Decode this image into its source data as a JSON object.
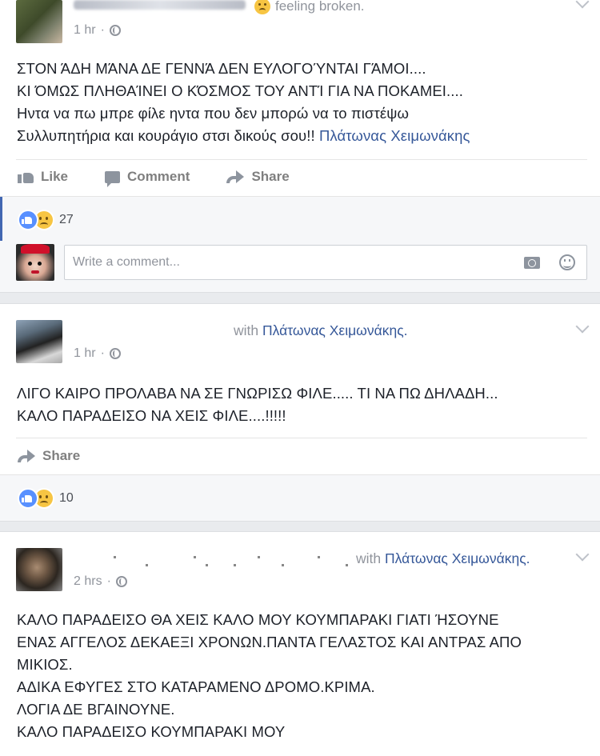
{
  "posts": [
    {
      "feeling": "feeling broken.",
      "time": "1 hr",
      "lines": [
        "ΣΤΟΝ ΆΔΗ ΜΆΝΑ ΔΕ ΓΕΝΝΆ ΔΕΝ ΕΥΛΟΓΟΎΝΤΑΙ ΓΆΜΟΙ....",
        "ΚΙ ΌΜΩΣ ΠΛΗΘΑΊΝΕΙ Ο ΚΌΣΜΟΣ ΤΟΥ ΑΝΤΊ ΓΙΑ ΝΑ ΠΟΚΑΜΕΙ....",
        "Ηντα να πω μπρε φίλε ηντα που δεν μπορώ να το πιστέψω"
      ],
      "last_line_prefix": "Συλλυπητήρια και κουράγιο στσι δικούς σου!!",
      "tagged": "Πλάτωνας Χειμωνάκης",
      "actions": {
        "like": "Like",
        "comment": "Comment",
        "share": "Share"
      },
      "reaction_count": "27",
      "comment_placeholder": "Write a comment..."
    },
    {
      "with_label": "with",
      "tagged": "Πλάτωνας Χειμωνάκης.",
      "time": "1 hr",
      "lines": [
        "ΛΙΓΟ ΚΑΙΡΟ ΠΡΟΛΑΒΑ ΝΑ ΣΕ ΓΝΩΡΙΣΩ ΦΙΛΕ..... ΤΙ ΝΑ ΠΩ ΔΗΛΑΔΗ...",
        "ΚΑΛΟ ΠΑΡΑΔΕΙΣΟ ΝΑ ΧΕΙΣ ΦΙΛΕ....!!!!!"
      ],
      "actions": {
        "share": "Share"
      },
      "reaction_count": "10"
    },
    {
      "with_label": "with",
      "tagged": "Πλάτωνας Χειμωνάκης.",
      "time": "2 hrs",
      "lines": [
        "ΚΑΛΟ ΠΑΡΑΔΕΙΣΟ ΘΑ ΧΕΙΣ ΚΑΛΟ ΜΟΥ ΚΟΥΜΠΑΡΑΚΙ ΓΙΑΤΙ ΉΣΟΥΝΕ",
        "ΕΝΑΣ ΑΓΓΕΛΟΣ ΔΕΚΑΕΞΙ ΧΡΟΝΩΝ.ΠΑΝΤΑ ΓΕΛΑΣΤΟΣ ΚΑΙ ΑΝΤΡΑΣ ΑΠΟ",
        "ΜΙΚΙΟΣ.",
        "ΑΔΙΚΑ ΕΦΥΓΕΣ ΣΤΟ ΚΑΤΑΡΑΜΕΝΟ ΔΡΟΜΟ.ΚΡΙΜΑ.",
        "ΛΟΓΙΑ ΔΕ ΒΓΑΙΝΟΥΝΕ.",
        "ΚΑΛΟ ΠΑΡΑΔΕΙΣΟ ΚΟΥΜΠΑΡΑΚΙ ΜΟΥ"
      ]
    }
  ],
  "colors": {
    "link": "#365899",
    "background": "#e9ebee",
    "like_blue": "#5890ff",
    "sad_yellow": "#f7c543"
  },
  "icons": [
    "like-icon",
    "comment-icon",
    "share-icon",
    "globe-icon",
    "camera-icon",
    "emoji-icon",
    "chevron-down-icon"
  ]
}
